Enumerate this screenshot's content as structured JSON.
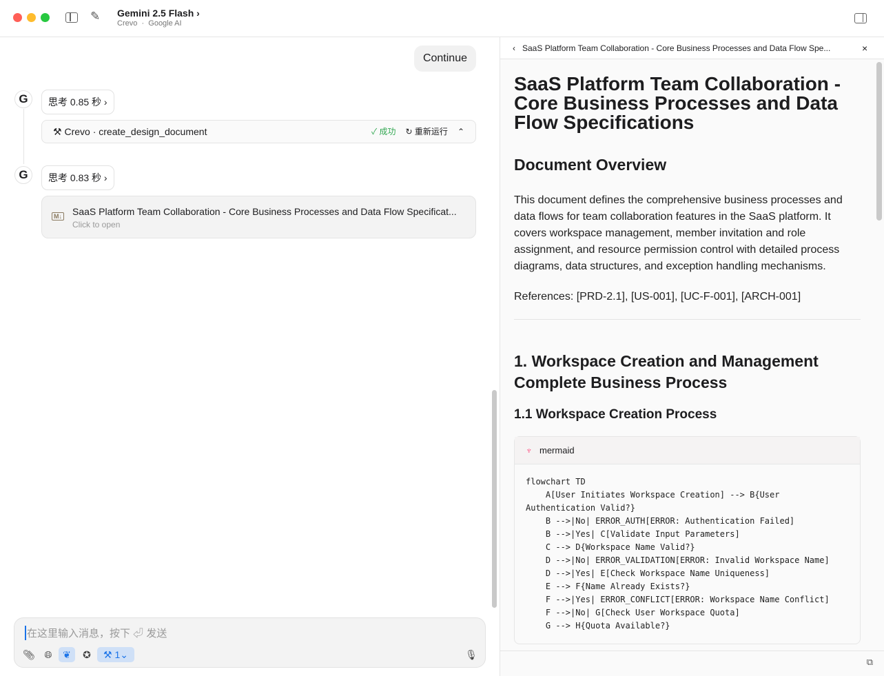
{
  "header": {
    "model": "Gemini 2.5 Flash",
    "provider": "Crevo",
    "separator": "·",
    "source": "Google AI"
  },
  "chat": {
    "user_message": "Continue",
    "think1": "思考 0.85 秒",
    "tool": {
      "name": "Crevo · create_design_document",
      "status": "成功",
      "rerun": "重新运行",
      "status_color": "#34a853"
    },
    "think2": "思考 0.83 秒",
    "file": {
      "badge": "M↓",
      "title": "SaaS Platform Team Collaboration - Core Business Processes and Data Flow Specificat...",
      "subtitle": "Click to open"
    }
  },
  "composer": {
    "placeholder": "在这里输入消息，按下 ⏎ 发送",
    "tool_count": "1"
  },
  "panel": {
    "header_title": "SaaS Platform Team Collaboration - Core Business Processes and Data Flow Spe...",
    "title": "SaaS Platform Team Collaboration - Core Business Processes and Data Flow Specifications",
    "overview_heading": "Document Overview",
    "overview_text": "This document defines the comprehensive business processes and data flows for team collaboration features in the SaaS platform. It covers workspace management, member invitation and role assignment, and resource permission control with detailed process diagrams, data structures, and exception handling mechanisms.",
    "references": "References: [PRD-2.1], [US-001], [UC-F-001], [ARCH-001]",
    "section1": "1. Workspace Creation and Management Complete Business Process",
    "section1_1": "1.1 Workspace Creation Process",
    "code_lang": "mermaid",
    "code": "flowchart TD\n    A[User Initiates Workspace Creation] --> B{User Authentication Valid?}\n    B -->|No| ERROR_AUTH[ERROR: Authentication Failed]\n    B -->|Yes| C[Validate Input Parameters]\n    C --> D{Workspace Name Valid?}\n    D -->|No| ERROR_VALIDATION[ERROR: Invalid Workspace Name]\n    D -->|Yes| E[Check Workspace Name Uniqueness]\n    E --> F{Name Already Exists?}\n    F -->|Yes| ERROR_CONFLICT[ERROR: Workspace Name Conflict]\n    F -->|No| G[Check User Workspace Quota]\n    G --> H{Quota Available?}"
  }
}
